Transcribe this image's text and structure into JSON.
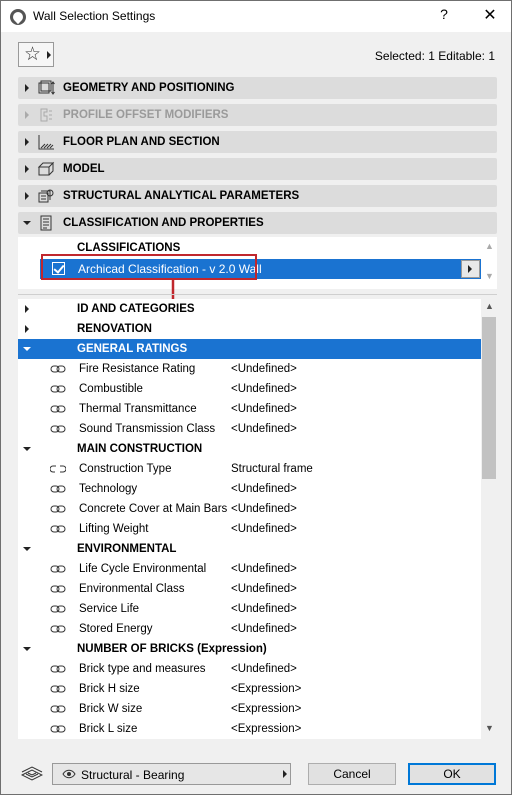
{
  "window": {
    "title": "Wall Selection Settings",
    "help": "?",
    "close": "✕"
  },
  "toolbar": {
    "favorites_star": "☆",
    "selected_info": "Selected: 1 Editable: 1"
  },
  "panels": [
    {
      "label": "GEOMETRY AND POSITIONING",
      "icon": "geometry-icon",
      "expanded": false,
      "enabled": true
    },
    {
      "label": "PROFILE OFFSET MODIFIERS",
      "icon": "profile-offset-icon",
      "expanded": false,
      "enabled": false
    },
    {
      "label": "FLOOR PLAN AND SECTION",
      "icon": "floor-plan-icon",
      "expanded": false,
      "enabled": true
    },
    {
      "label": "MODEL",
      "icon": "model-icon",
      "expanded": false,
      "enabled": true
    },
    {
      "label": "STRUCTURAL ANALYTICAL PARAMETERS",
      "icon": "structural-analytical-icon",
      "expanded": false,
      "enabled": true
    },
    {
      "label": "CLASSIFICATION AND PROPERTIES",
      "icon": "classification-icon",
      "expanded": true,
      "enabled": true
    }
  ],
  "classifications": {
    "header": "CLASSIFICATIONS",
    "item": "Archicad Classification - v 2.0 Wall",
    "checked": true
  },
  "properties": {
    "groups": [
      {
        "name": "ID AND CATEGORIES",
        "expanded": false,
        "selected": false,
        "items": []
      },
      {
        "name": "RENOVATION",
        "expanded": false,
        "selected": false,
        "items": []
      },
      {
        "name": "GENERAL RATINGS",
        "expanded": true,
        "selected": true,
        "items": [
          {
            "name": "Fire Resistance Rating",
            "value": "<Undefined>"
          },
          {
            "name": "Combustible",
            "value": "<Undefined>"
          },
          {
            "name": "Thermal Transmittance",
            "value": "<Undefined>"
          },
          {
            "name": "Sound Transmission Class",
            "value": "<Undefined>"
          }
        ]
      },
      {
        "name": "MAIN CONSTRUCTION",
        "expanded": true,
        "selected": false,
        "items": [
          {
            "name": "Construction Type",
            "value": "Structural frame",
            "unlinked": true
          },
          {
            "name": "Technology",
            "value": "<Undefined>"
          },
          {
            "name": "Concrete Cover at Main Bars",
            "value": "<Undefined>"
          },
          {
            "name": "Lifting Weight",
            "value": "<Undefined>"
          }
        ]
      },
      {
        "name": "ENVIRONMENTAL",
        "expanded": true,
        "selected": false,
        "items": [
          {
            "name": "Life Cycle Environmental",
            "value": "<Undefined>"
          },
          {
            "name": "Environmental Class",
            "value": "<Undefined>"
          },
          {
            "name": "Service Life",
            "value": "<Undefined>"
          },
          {
            "name": "Stored Energy",
            "value": "<Undefined>"
          }
        ]
      },
      {
        "name": "NUMBER OF BRICKS (Expression)",
        "expanded": true,
        "selected": false,
        "items": [
          {
            "name": "Brick type and measures",
            "value": "<Undefined>"
          },
          {
            "name": "Brick H size",
            "value": "<Expression>"
          },
          {
            "name": "Brick W size",
            "value": "<Expression>"
          },
          {
            "name": "Brick L size",
            "value": "<Expression>"
          }
        ]
      }
    ]
  },
  "footer": {
    "structural_function": "Structural - Bearing",
    "cancel_label": "Cancel",
    "ok_label": "OK"
  },
  "colors": {
    "selection": "#1a73d1",
    "highlight_box": "#c0272d",
    "panel_bg": "#dcdcdc"
  }
}
